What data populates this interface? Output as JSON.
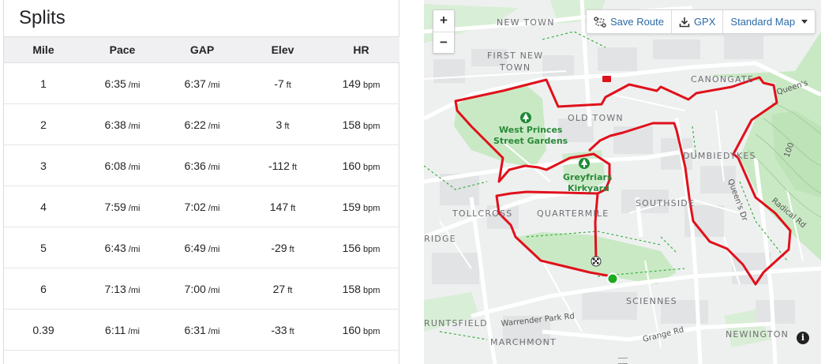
{
  "splits": {
    "title": "Splits",
    "headers": [
      "Mile",
      "Pace",
      "GAP",
      "Elev",
      "HR"
    ],
    "rows": [
      {
        "mile": "1",
        "pace": "6:35",
        "pace_unit": "/mi",
        "gap": "6:37",
        "gap_unit": "/mi",
        "elev": "-7",
        "elev_unit": "ft",
        "hr": "149",
        "hr_unit": "bpm"
      },
      {
        "mile": "2",
        "pace": "6:38",
        "pace_unit": "/mi",
        "gap": "6:22",
        "gap_unit": "/mi",
        "elev": "3",
        "elev_unit": "ft",
        "hr": "158",
        "hr_unit": "bpm"
      },
      {
        "mile": "3",
        "pace": "6:08",
        "pace_unit": "/mi",
        "gap": "6:36",
        "gap_unit": "/mi",
        "elev": "-112",
        "elev_unit": "ft",
        "hr": "160",
        "hr_unit": "bpm"
      },
      {
        "mile": "4",
        "pace": "7:59",
        "pace_unit": "/mi",
        "gap": "7:02",
        "gap_unit": "/mi",
        "elev": "147",
        "elev_unit": "ft",
        "hr": "159",
        "hr_unit": "bpm"
      },
      {
        "mile": "5",
        "pace": "6:43",
        "pace_unit": "/mi",
        "gap": "6:49",
        "gap_unit": "/mi",
        "elev": "-29",
        "elev_unit": "ft",
        "hr": "156",
        "hr_unit": "bpm"
      },
      {
        "mile": "6",
        "pace": "7:13",
        "pace_unit": "/mi",
        "gap": "7:00",
        "gap_unit": "/mi",
        "elev": "27",
        "elev_unit": "ft",
        "hr": "158",
        "hr_unit": "bpm"
      },
      {
        "mile": "0.39",
        "pace": "6:11",
        "pace_unit": "/mi",
        "gap": "6:31",
        "gap_unit": "/mi",
        "elev": "-33",
        "elev_unit": "ft",
        "hr": "160",
        "hr_unit": "bpm"
      }
    ]
  },
  "map": {
    "zoom_in": "+",
    "zoom_out": "−",
    "toolbar": {
      "save_route": "Save Route",
      "gpx": "GPX",
      "map_style": "Standard Map"
    },
    "info": "i",
    "places": {
      "new_town": "NEW TOWN",
      "first_new_town_1": "FIRST NEW",
      "first_new_town_2": "TOWN",
      "canongate": "CANONGATE",
      "old_town": "OLD TOWN",
      "dumbiedykes": "DUMBIEDYKES",
      "tollcross": "TOLLCROSS",
      "quartermile": "QUARTERMILE",
      "southside": "SOUTHSIDE",
      "bridge": "RIDGE",
      "sciennes": "SCIENNES",
      "bruntsfield": "RUNTSFIELD",
      "marchmont": "MARCHMONT",
      "newington": "NEWINGTON"
    },
    "parks": {
      "west_princes_1": "West Princes",
      "west_princes_2": "Street Gardens",
      "greyfriars_1": "Greyfriars",
      "greyfriars_2": "Kirkyard"
    },
    "roads": {
      "queens": "Queen's",
      "radical": "Radical Rd",
      "queens_dr": "Queen's Dr",
      "warrender": "Warrender Park Rd",
      "grange": "Grange Rd",
      "elevation_tag": "100"
    },
    "colors": {
      "route": "#e0111b",
      "start": "#1ea91e",
      "park": "#c9e9c4",
      "background": "#eef0f0"
    }
  }
}
